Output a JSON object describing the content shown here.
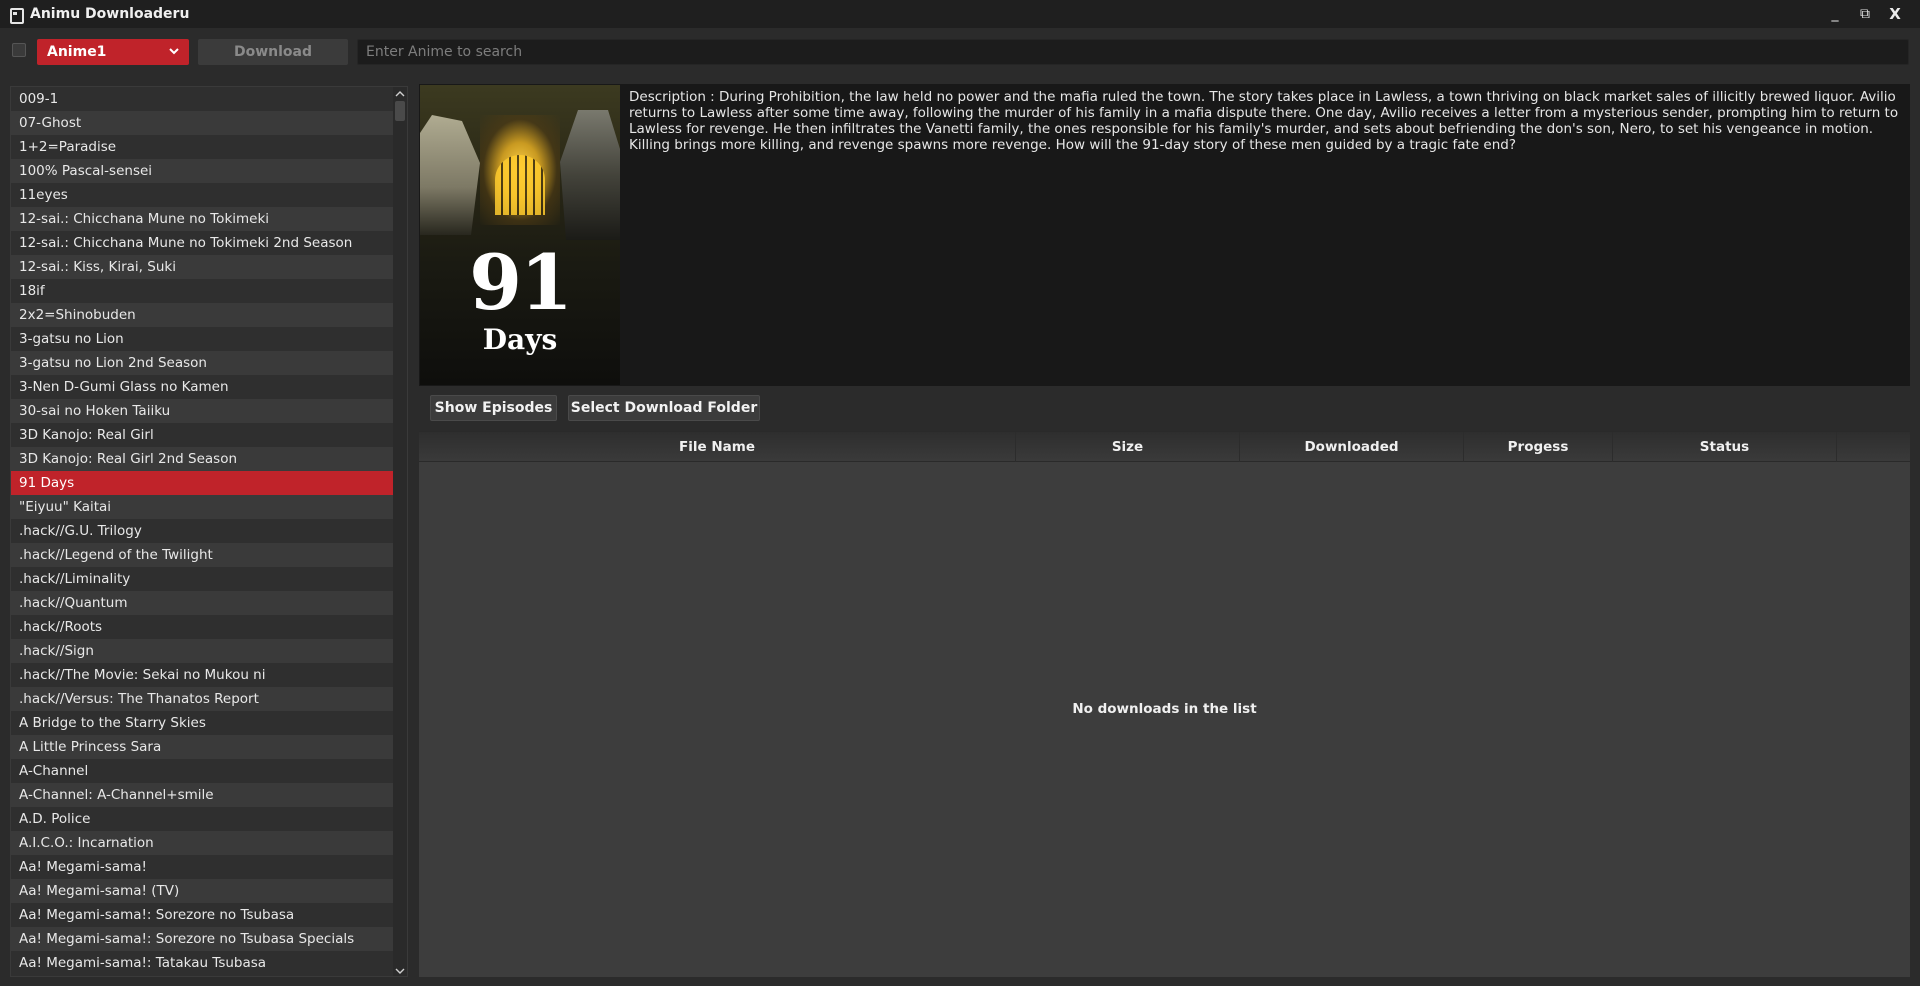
{
  "window": {
    "title": "Animu Downloaderu",
    "minimize": "_",
    "maximize": "⧉",
    "close": "X"
  },
  "toolbar": {
    "source_selected": "Anime1",
    "download_label": "Download",
    "search_placeholder": "Enter Anime to search",
    "search_value": ""
  },
  "anime_list": {
    "selected": "91 Days",
    "items": [
      "009-1",
      "07-Ghost",
      "1+2=Paradise",
      "100% Pascal-sensei",
      "11eyes",
      "12-sai.: Chicchana Mune no Tokimeki",
      "12-sai.: Chicchana Mune no Tokimeki 2nd Season",
      "12-sai.: Kiss, Kirai, Suki",
      "18if",
      "2x2=Shinobuden",
      "3-gatsu no Lion",
      "3-gatsu no Lion 2nd Season",
      "3-Nen D-Gumi Glass no Kamen",
      "30-sai no Hoken Taiiku",
      "3D Kanojo: Real Girl",
      "3D Kanojo: Real Girl 2nd Season",
      "91 Days",
      "\"Eiyuu\" Kaitai",
      ".hack//G.U. Trilogy",
      ".hack//Legend of the Twilight",
      ".hack//Liminality",
      ".hack//Quantum",
      ".hack//Roots",
      ".hack//Sign",
      ".hack//The Movie: Sekai no Mukou ni",
      ".hack//Versus: The Thanatos Report",
      "A Bridge to the Starry Skies",
      "A Little Princess Sara",
      "A-Channel",
      "A-Channel: A-Channel+smile",
      "A.D. Police",
      "A.I.C.O.: Incarnation",
      "Aa! Megami-sama!",
      "Aa! Megami-sama! (TV)",
      "Aa! Megami-sama!: Sorezore no Tsubasa",
      "Aa! Megami-sama!: Sorezore no Tsubasa Specials",
      "Aa! Megami-sama!: Tatakau Tsubasa"
    ]
  },
  "details": {
    "poster_number": "91",
    "poster_word": "Days",
    "description": "Description : During Prohibition, the law held no power and the mafia ruled the town. The story takes place in Lawless, a town thriving on black market sales of illicitly brewed liquor. Avilio returns to Lawless after some time away, following the murder of his family in a mafia dispute there. One day, Avilio receives a letter from a mysterious sender, prompting him to return to Lawless for revenge. He then infiltrates the Vanetti family, the ones responsible for his family's murder, and sets about befriending the don's son, Nero, to set his vengeance in motion. Killing brings more killing, and revenge spawns more revenge. How will the 91-day story of these men guided by a tragic fate end?"
  },
  "actions": {
    "show_episodes": "Show Episodes",
    "select_folder": "Select Download Folder"
  },
  "downloads_table": {
    "columns": [
      "File Name",
      "Size",
      "Downloaded",
      "Progess",
      "Status",
      ""
    ],
    "rows": [],
    "empty_message": "No downloads in the list"
  },
  "colors": {
    "accent": "#c0232a",
    "background": "#2b2b2b",
    "panel_dark": "#181818"
  }
}
